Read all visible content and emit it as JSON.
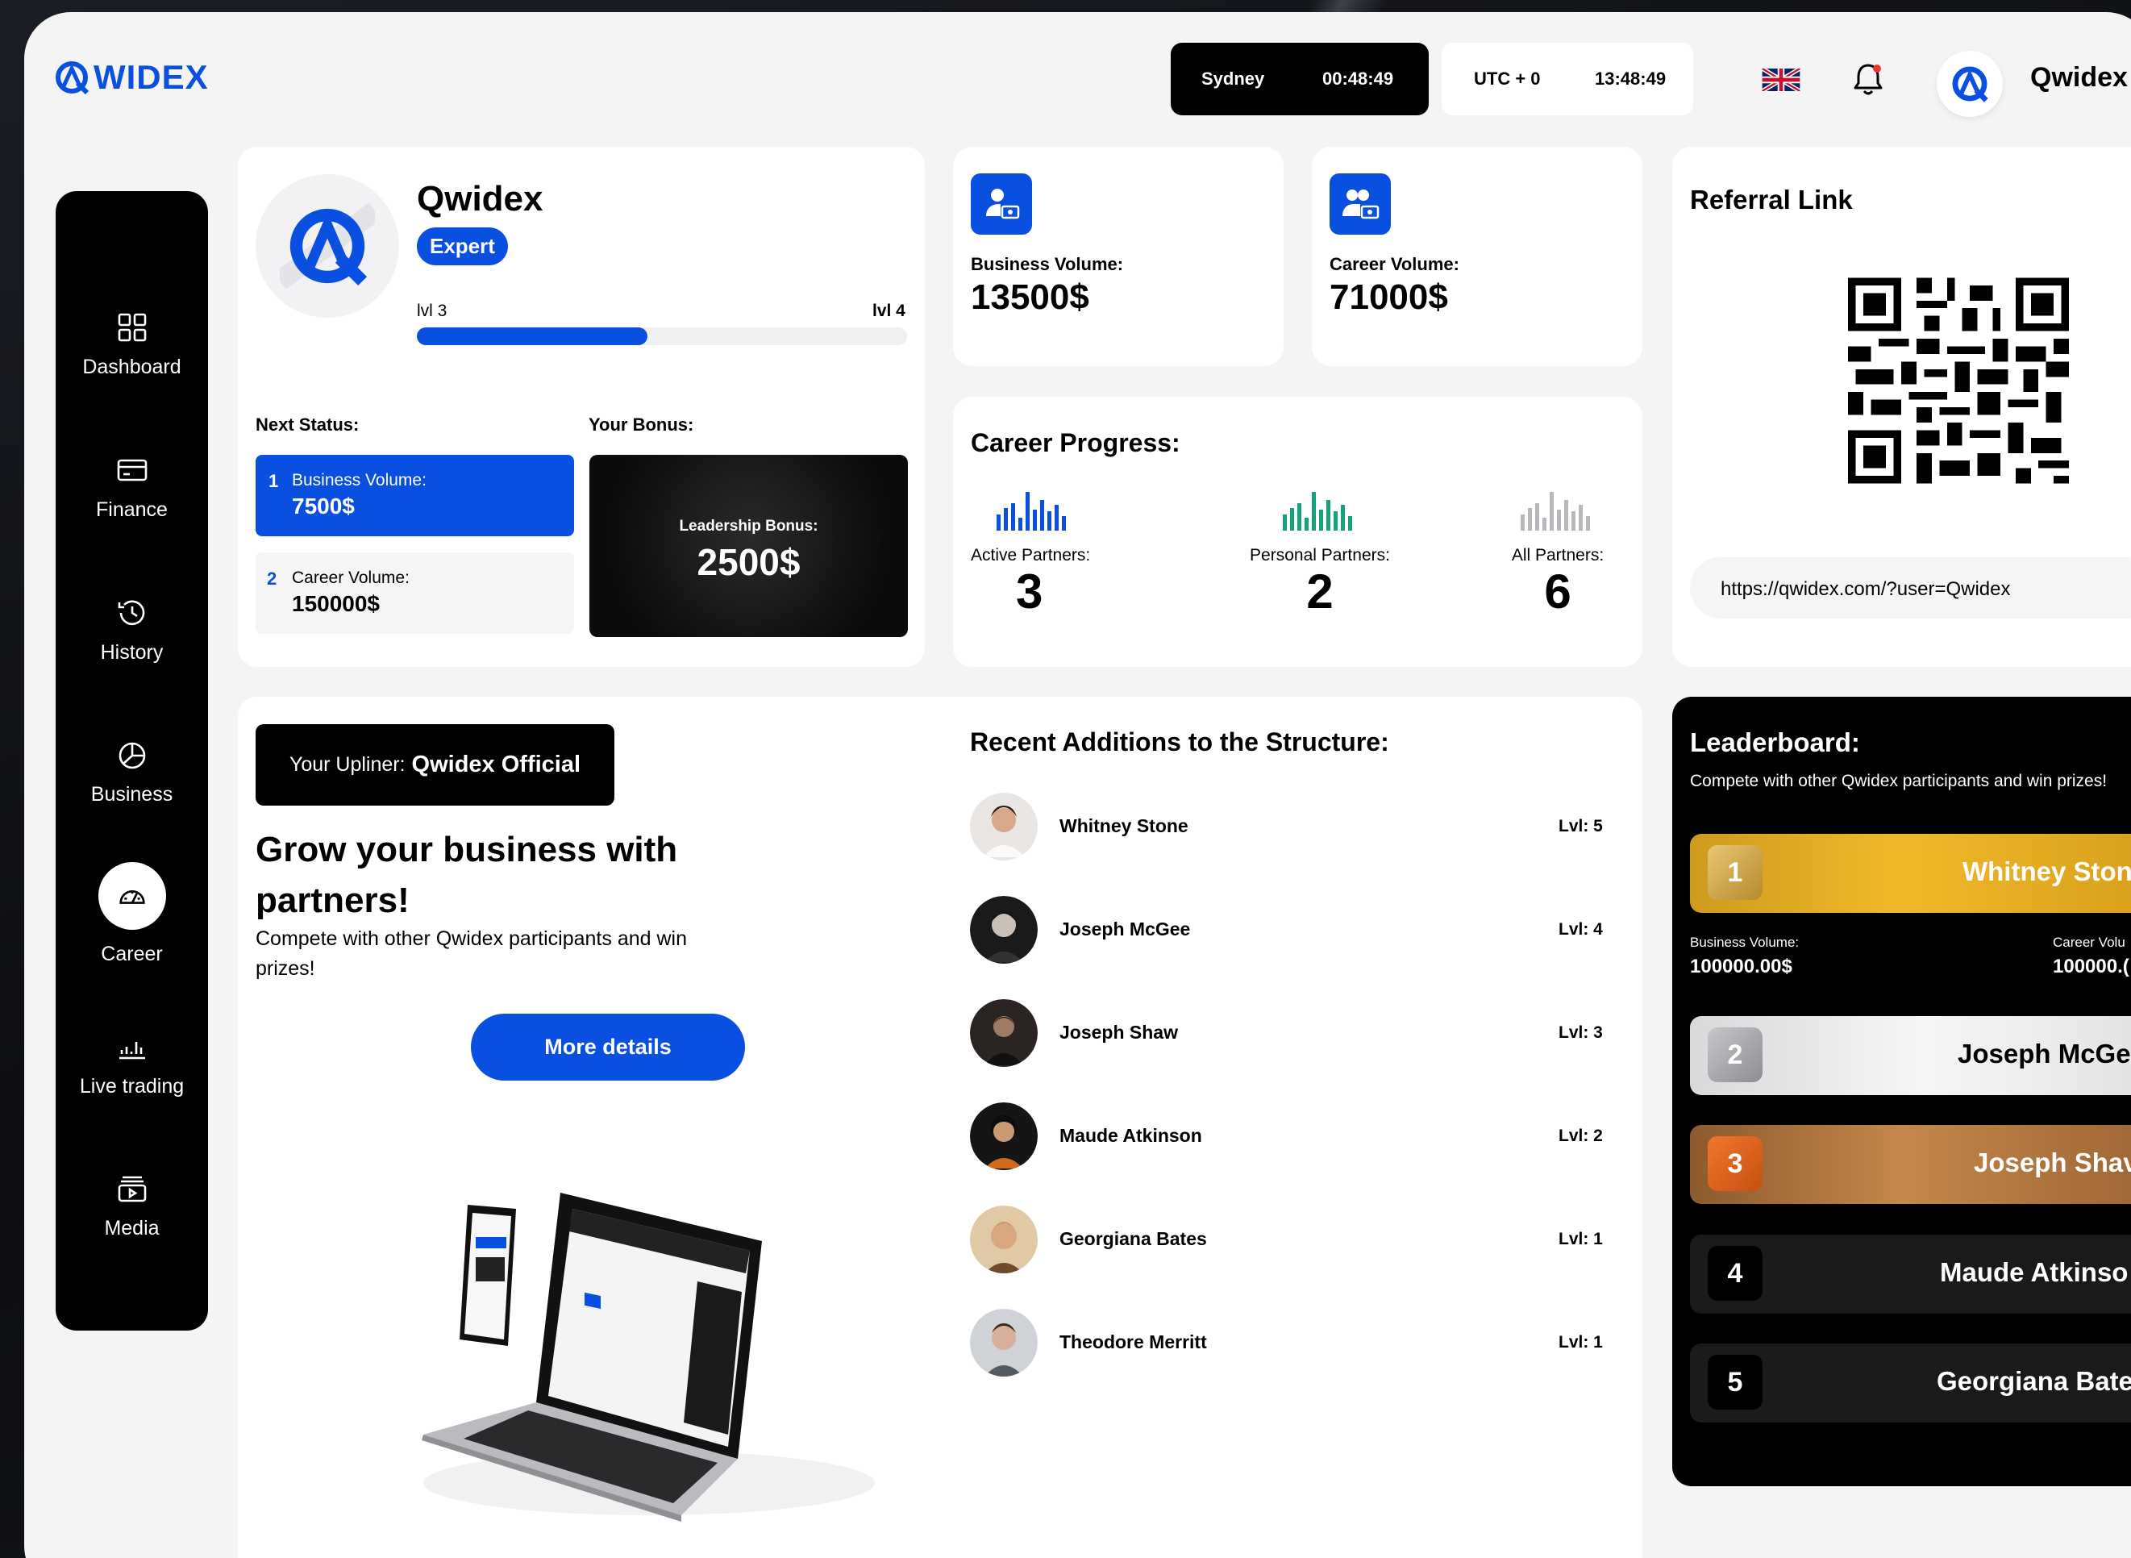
{
  "header": {
    "logo_text": "WIDEX",
    "city": "Sydney",
    "city_time": "00:48:49",
    "utc_label": "UTC + 0",
    "utc_time": "13:48:49",
    "user_name": "Qwidex"
  },
  "sidebar": {
    "items": [
      {
        "label": "Dashboard",
        "icon": "grid-icon"
      },
      {
        "label": "Finance",
        "icon": "card-icon"
      },
      {
        "label": "History",
        "icon": "history-icon"
      },
      {
        "label": "Business",
        "icon": "pie-icon"
      },
      {
        "label": "Career",
        "icon": "speedometer-icon",
        "active": true
      },
      {
        "label": "Live trading",
        "icon": "bars-icon"
      },
      {
        "label": "Media",
        "icon": "media-icon"
      }
    ]
  },
  "profile": {
    "name": "Qwidex",
    "badge": "Expert",
    "level_from": "lvl 3",
    "level_to": "lvl 4",
    "progress": 0.47,
    "next_status_title": "Next Status:",
    "bonus_title": "Your Bonus:",
    "req1_num": "1",
    "req1_label": "Business Volume:",
    "req1_value": "7500$",
    "req2_num": "2",
    "req2_label": "Career Volume:",
    "req2_value": "150000$",
    "bonus_label": "Leadership Bonus:",
    "bonus_value": "2500$"
  },
  "volumes": {
    "business_label": "Business Volume:",
    "business_value": "13500$",
    "career_label": "Career Volume:",
    "career_value": "71000$"
  },
  "career_progress": {
    "title": "Career Progress:",
    "stats": [
      {
        "label": "Active Partners:",
        "value": "3",
        "color": "#0a50e0"
      },
      {
        "label": "Personal Partners:",
        "value": "2",
        "color": "#13a37c"
      },
      {
        "label": "All Partners:",
        "value": "6",
        "color": "#b8b8bc"
      }
    ]
  },
  "referral": {
    "title": "Referral Link",
    "url": "https://qwidex.com/?user=Qwidex"
  },
  "promo": {
    "upliner_prefix": "Your Upliner:",
    "upliner_name": "Qwidex Official",
    "headline_1": "Grow your business with",
    "headline_2": "partners!",
    "text_1": "Compete with other Qwidex participants and win",
    "text_2": "prizes!",
    "button": "More details"
  },
  "recent": {
    "title": "Recent Additions to the Structure:",
    "people": [
      {
        "name": "Whitney Stone",
        "level": "Lvl: 5"
      },
      {
        "name": "Joseph McGee",
        "level": "Lvl: 4"
      },
      {
        "name": "Joseph Shaw",
        "level": "Lvl: 3"
      },
      {
        "name": "Maude Atkinson",
        "level": "Lvl: 2"
      },
      {
        "name": "Georgiana Bates",
        "level": "Lvl: 1"
      },
      {
        "name": "Theodore Merritt",
        "level": "Lvl: 1"
      }
    ]
  },
  "leaderboard": {
    "title": "Leaderboard:",
    "subtitle": "Compete with other Qwidex participants and win prizes!",
    "business_label": "Business Volume:",
    "business_value": "100000.00$",
    "career_label": "Career Volu",
    "career_value": "100000.(",
    "rows": [
      {
        "rank": "1",
        "name": "Whitney Ston"
      },
      {
        "rank": "2",
        "name": "Joseph McGe"
      },
      {
        "rank": "3",
        "name": "Joseph Shav"
      },
      {
        "rank": "4",
        "name": "Maude Atkinso"
      },
      {
        "rank": "5",
        "name": "Georgiana Bate"
      }
    ]
  }
}
